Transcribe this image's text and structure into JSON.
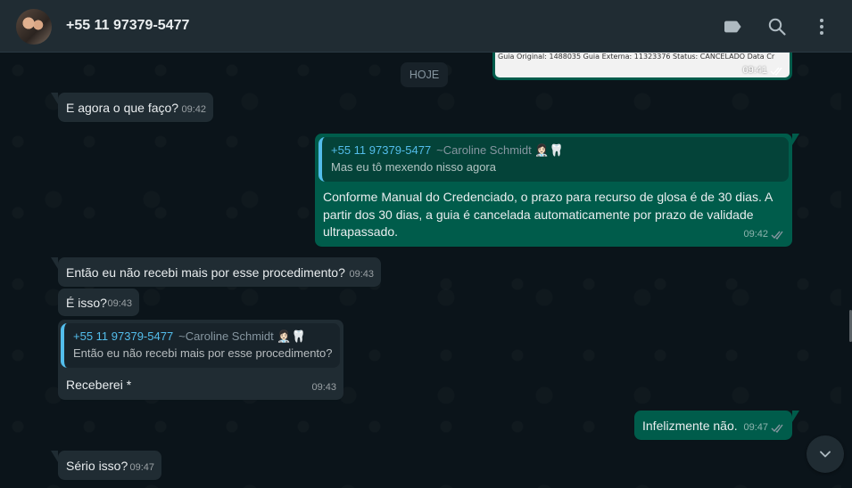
{
  "header": {
    "contact_name": "+55 11 97379-5477",
    "icons": [
      "label-icon",
      "search-icon",
      "menu-icon"
    ]
  },
  "date_chip": "HOJE",
  "image_message": {
    "caption_text": "Guia Original: 1488035 Guia Externa: 11323376 Status: CANCELADO Data Cr",
    "time": "09:41"
  },
  "messages": [
    {
      "direction": "in",
      "text": "E agora o que faço?",
      "time": "09:42"
    },
    {
      "direction": "out",
      "quote": {
        "author": "+55 11 97379-5477",
        "nick": "~Caroline Schmidt 👩🏻‍⚕️🦷",
        "text": "Mas eu tô mexendo nisso agora"
      },
      "text": "Conforme Manual do Credenciado, o prazo para recurso de glosa é de 30 dias. A partir dos 30 dias, a guia é cancelada automaticamente por prazo de validade ultrapassado.",
      "time": "09:42"
    },
    {
      "direction": "in",
      "text": "Então eu não recebi mais por esse procedimento?",
      "time": "09:43"
    },
    {
      "direction": "in",
      "text": "É isso?",
      "time": "09:43"
    },
    {
      "direction": "in",
      "quote": {
        "author": "+55 11 97379-5477",
        "nick": "~Caroline Schmidt 👩🏻‍⚕️🦷",
        "text": "Então eu não recebi mais por esse procedimento?"
      },
      "text": "Receberei *",
      "time": "09:43"
    },
    {
      "direction": "out",
      "text": "Infelizmente não.",
      "time": "09:47"
    },
    {
      "direction": "in",
      "text": "Sério isso?",
      "time": "09:47"
    }
  ],
  "colors": {
    "header_bg": "#202c33",
    "chat_bg": "#0b141a",
    "incoming_bubble": "#202c33",
    "outgoing_bubble": "#005c4b",
    "quote_accent": "#53bdeb",
    "read_ticks": "#8696a0"
  },
  "scroll_down_icon": "chevron-down-icon"
}
